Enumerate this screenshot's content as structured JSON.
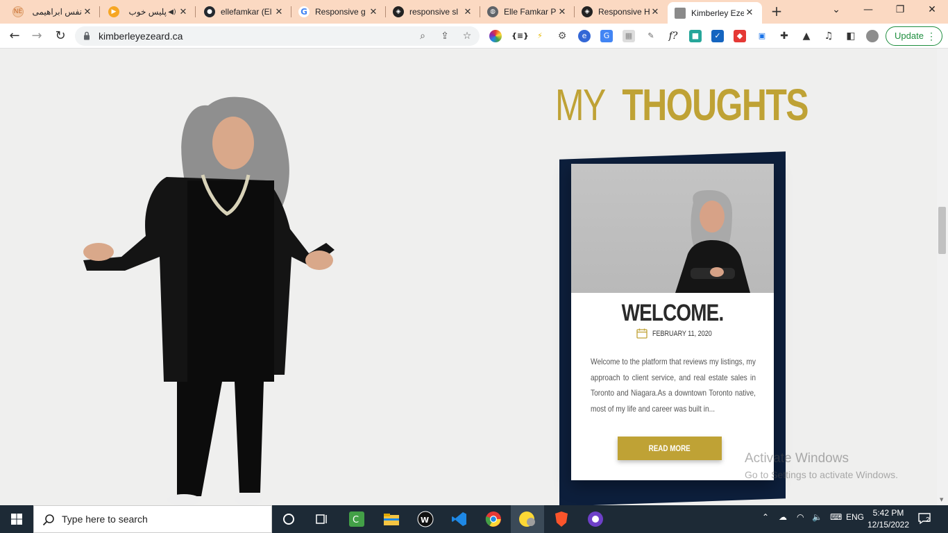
{
  "browser": {
    "tabs": [
      {
        "title": "نفس ابراهیمی",
        "favicon": "ne-favicon-icon",
        "active": false
      },
      {
        "title": "پلیس خوب",
        "favicon": "play-favicon-icon",
        "audio": true,
        "active": false
      },
      {
        "title": "ellefamkar (El",
        "favicon": "github-icon",
        "active": false
      },
      {
        "title": "Responsive g",
        "favicon": "google-icon",
        "active": false
      },
      {
        "title": "responsive sl",
        "favicon": "codepen-icon",
        "active": false
      },
      {
        "title": "Elle Famkar P",
        "favicon": "globe-icon",
        "active": false
      },
      {
        "title": "Responsive H",
        "favicon": "codepen-icon",
        "active": false
      },
      {
        "title": "Kimberley Eze",
        "favicon": "site-favicon-icon",
        "active": true
      }
    ],
    "url": "kimberleyezeard.ca",
    "update_label": "Update"
  },
  "page": {
    "heading_light": "MY",
    "heading_bold": "THOUGHTS",
    "card": {
      "title": "WELCOME.",
      "date": "FEBRUARY 11, 2020",
      "excerpt": "Welcome to the platform that reviews my listings, my approach to client service, and real estate sales in Toronto and Niagara.As a downtown Toronto native, most of my life and career was built in...",
      "button": "READ MORE"
    },
    "accent_color": "#bfa235",
    "navy_color": "#0d1f3c"
  },
  "watermark": {
    "line1": "Activate Windows",
    "line2": "Go to Settings to activate Windows."
  },
  "taskbar": {
    "search_placeholder": "Type here to search",
    "language": "ENG",
    "time": "5:42 PM",
    "date": "12/15/2022",
    "notification_count": "2"
  }
}
